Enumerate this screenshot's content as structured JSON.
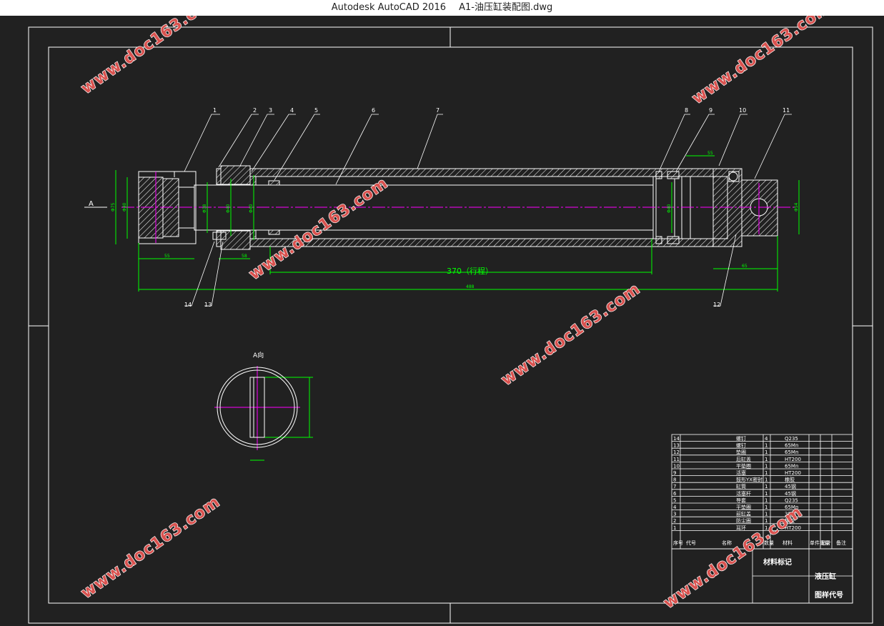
{
  "window": {
    "app_title": "Autodesk AutoCAD 2016",
    "file_title": "A1-油压缸装配图.dwg"
  },
  "colors": {
    "background": "#212121",
    "line": "#ffffff",
    "dimension": "#00ff00",
    "centerline": "#ff00ff",
    "watermark": "#d9524f"
  },
  "drawing": {
    "section_marker": "A",
    "view_title": "A向",
    "stroke_dimension": "370（行程）",
    "balloons": [
      "1",
      "2",
      "3",
      "4",
      "5",
      "6",
      "7",
      "8",
      "9",
      "10",
      "11",
      "14",
      "13",
      "12"
    ],
    "dimensions": {
      "d_left_outer": "Φ75",
      "d_left_inner": "Φ40",
      "d_bore_a": "Φ38",
      "d_bore_b": "Φ40",
      "d_bore_c": "Φ40",
      "d_piston": "Φ40",
      "d_right": "Φ54",
      "len_left": "55",
      "len_cap": "58",
      "len_top_right": "55",
      "len_right": "65",
      "len_total": "488"
    }
  },
  "bom": {
    "rows": [
      {
        "no": "14",
        "name": "螺钉",
        "qty": "4",
        "material": "Q235"
      },
      {
        "no": "13",
        "name": "螺钉",
        "qty": "1",
        "material": "65Mn"
      },
      {
        "no": "12",
        "name": "垫圈",
        "qty": "1",
        "material": "65Mn"
      },
      {
        "no": "11",
        "name": "后缸盖",
        "qty": "1",
        "material": "HT200"
      },
      {
        "no": "10",
        "name": "平垫圈",
        "qty": "1",
        "material": "65Mn"
      },
      {
        "no": "9",
        "name": "活塞",
        "qty": "1",
        "material": "HT200"
      },
      {
        "no": "8",
        "name": "鼓形YX密封",
        "qty": "1",
        "material": "橡胶"
      },
      {
        "no": "7",
        "name": "缸筒",
        "qty": "1",
        "material": "45钢"
      },
      {
        "no": "6",
        "name": "活塞杆",
        "qty": "1",
        "material": "45钢"
      },
      {
        "no": "5",
        "name": "导套",
        "qty": "1",
        "material": "Q235"
      },
      {
        "no": "4",
        "name": "平垫圈",
        "qty": "1",
        "material": "65Mn"
      },
      {
        "no": "3",
        "name": "前缸盖",
        "qty": "1",
        "material": "35钢"
      },
      {
        "no": "2",
        "name": "防尘圈",
        "qty": "1",
        "material": "橡胶"
      },
      {
        "no": "1",
        "name": "耳环",
        "qty": "1",
        "material": "HT200"
      }
    ],
    "header": {
      "no": "序号",
      "code": "代号",
      "name": "名称",
      "qty": "数量",
      "material": "材料",
      "weight": "单件重量",
      "total": "总计",
      "remark": "备注"
    },
    "title_material": "材料标记",
    "title_name": "液压缸",
    "title_code": "图样代号"
  },
  "watermark": "www.doc163.com"
}
